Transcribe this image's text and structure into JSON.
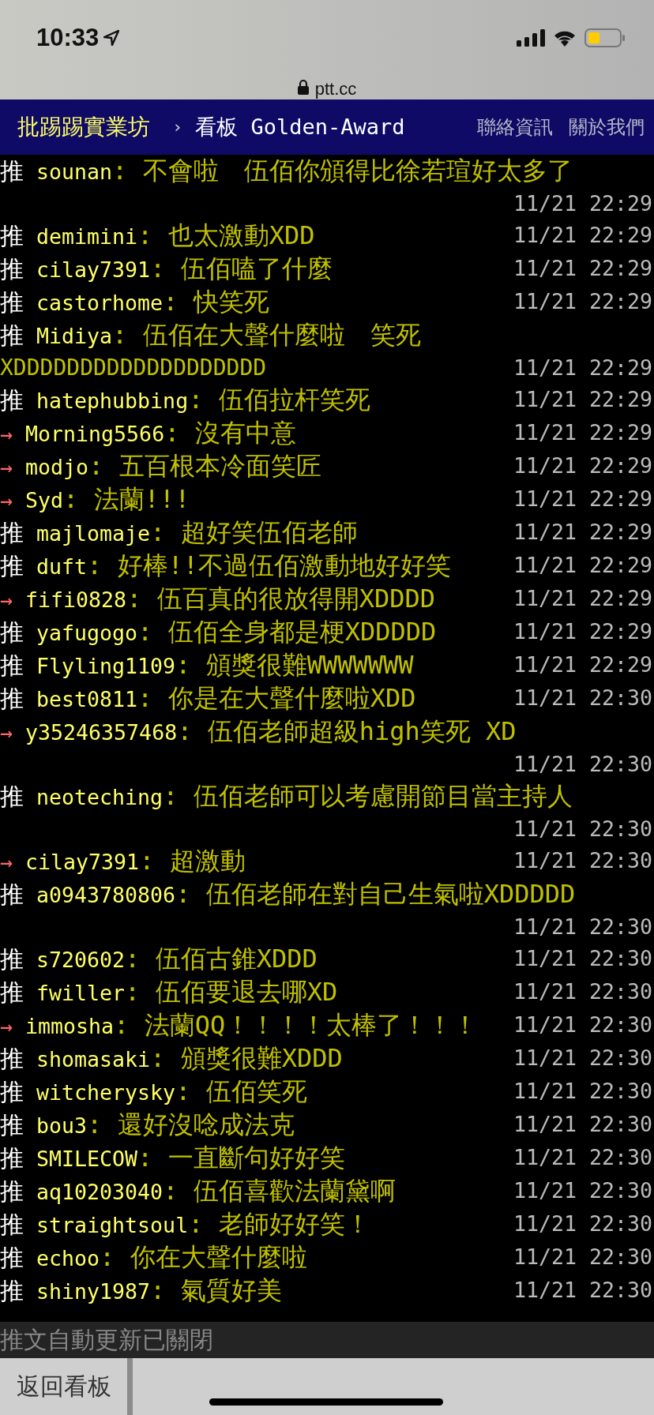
{
  "status_bar": {
    "time": "10:33"
  },
  "address_bar": {
    "url": "ptt.cc"
  },
  "nav": {
    "site": "批踢踢實業坊",
    "separator": "›",
    "board": "看板 Golden-Award",
    "links": [
      "聯絡資訊",
      "關於我們"
    ]
  },
  "pushes": [
    {
      "kind": "push",
      "tag": "推",
      "user": "sounan",
      "content": ": 不會啦　伍佰你頒得比徐若瑄好太多了",
      "time": "11/21 22:29"
    },
    {
      "kind": "push",
      "tag": "推",
      "user": "demimini",
      "content": ": 也太激動XDD",
      "time": "11/21 22:29"
    },
    {
      "kind": "push",
      "tag": "推",
      "user": "cilay7391",
      "content": ": 伍佰嗑了什麼",
      "time": "11/21 22:29"
    },
    {
      "kind": "push",
      "tag": "推",
      "user": "castorhome",
      "content": ": 快笑死",
      "time": "11/21 22:29"
    },
    {
      "kind": "push",
      "tag": "推",
      "user": "Midiya",
      "content": ": 伍佰在大聲什麼啦　笑死",
      "continuation": "XDDDDDDDDDDDDDDDDDDD",
      "time": "11/21 22:29"
    },
    {
      "kind": "push",
      "tag": "推",
      "user": "hatephubbing",
      "content": ": 伍佰拉杆笑死",
      "time": "11/21 22:29"
    },
    {
      "kind": "arrow",
      "tag": "→",
      "user": "Morning5566",
      "content": ": 沒有中意",
      "time": "11/21 22:29"
    },
    {
      "kind": "arrow",
      "tag": "→",
      "user": "modjo",
      "content": ": 五百根本冷面笑匠",
      "time": "11/21 22:29"
    },
    {
      "kind": "arrow",
      "tag": "→",
      "user": "Syd",
      "content": ": 法蘭!!!",
      "time": "11/21 22:29"
    },
    {
      "kind": "push",
      "tag": "推",
      "user": "majlomaje",
      "content": ": 超好笑伍佰老師",
      "time": "11/21 22:29"
    },
    {
      "kind": "push",
      "tag": "推",
      "user": "duft",
      "content": ": 好棒!!不過伍佰激動地好好笑",
      "time": "11/21 22:29"
    },
    {
      "kind": "arrow",
      "tag": "→",
      "user": "fifi0828",
      "content": ": 伍百真的很放得開XDDDD",
      "time": "11/21 22:29"
    },
    {
      "kind": "push",
      "tag": "推",
      "user": "yafugogo",
      "content": ": 伍佰全身都是梗XDDDDD",
      "time": "11/21 22:29"
    },
    {
      "kind": "push",
      "tag": "推",
      "user": "Flyling1109",
      "content": ": 頒獎很難WWWWWWW",
      "time": "11/21 22:29"
    },
    {
      "kind": "push",
      "tag": "推",
      "user": "best0811",
      "content": ": 你是在大聲什麼啦XDD",
      "time": "11/21 22:30"
    },
    {
      "kind": "arrow",
      "tag": "→",
      "user": "y35246357468",
      "content": ": 伍佰老師超級high笑死 XD",
      "time": "11/21 22:30"
    },
    {
      "kind": "push",
      "tag": "推",
      "user": "neoteching",
      "content": ": 伍佰老師可以考慮開節目當主持人",
      "time": "11/21 22:30"
    },
    {
      "kind": "arrow",
      "tag": "→",
      "user": "cilay7391",
      "content": ": 超激動",
      "time": "11/21 22:30"
    },
    {
      "kind": "push",
      "tag": "推",
      "user": "a0943780806",
      "content": ": 伍佰老師在對自己生氣啦XDDDDD",
      "time": "11/21 22:30"
    },
    {
      "kind": "push",
      "tag": "推",
      "user": "s720602",
      "content": ": 伍佰古錐XDDD",
      "time": "11/21 22:30"
    },
    {
      "kind": "push",
      "tag": "推",
      "user": "fwiller",
      "content": ": 伍佰要退去哪XD",
      "time": "11/21 22:30"
    },
    {
      "kind": "arrow",
      "tag": "→",
      "user": "immosha",
      "content": ": 法蘭QQ！！！！太棒了！！！",
      "time": "11/21 22:30"
    },
    {
      "kind": "push",
      "tag": "推",
      "user": "shomasaki",
      "content": ": 頒獎很難XDDD",
      "time": "11/21 22:30"
    },
    {
      "kind": "push",
      "tag": "推",
      "user": "witcherysky",
      "content": ": 伍佰笑死",
      "time": "11/21 22:30"
    },
    {
      "kind": "push",
      "tag": "推",
      "user": "bou3",
      "content": ": 還好沒唸成法克",
      "time": "11/21 22:30"
    },
    {
      "kind": "push",
      "tag": "推",
      "user": "SMILECOW",
      "content": ": 一直斷句好好笑",
      "time": "11/21 22:30"
    },
    {
      "kind": "push",
      "tag": "推",
      "user": "aq10203040",
      "content": ": 伍佰喜歡法蘭黛啊",
      "time": "11/21 22:30"
    },
    {
      "kind": "push",
      "tag": "推",
      "user": "straightsoul",
      "content": ": 老師好好笑！",
      "time": "11/21 22:30"
    },
    {
      "kind": "push",
      "tag": "推",
      "user": "echoo",
      "content": ": 你在大聲什麼啦",
      "time": "11/21 22:30"
    },
    {
      "kind": "push",
      "tag": "推",
      "user": "shiny1987",
      "content": ": 氣質好美",
      "time": "11/21 22:30"
    }
  ],
  "auto_update_notice": "推文自動更新已關閉",
  "bottom_bar": {
    "back_button": "返回看板"
  }
}
